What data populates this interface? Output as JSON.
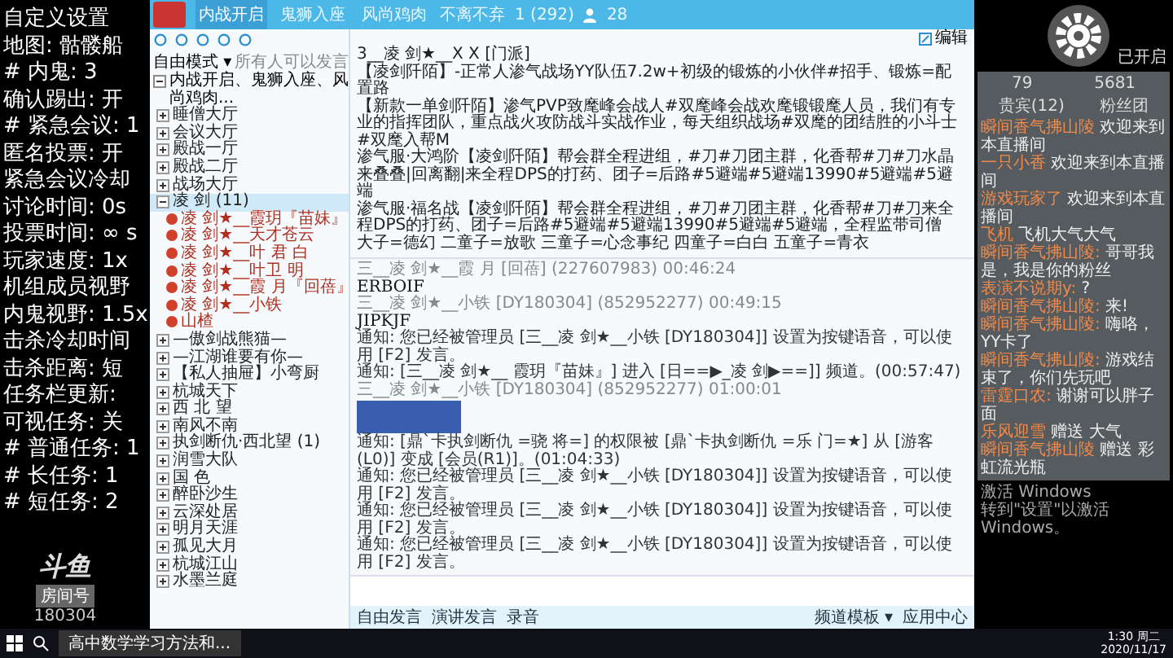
{
  "overlay": {
    "settings": [
      "自定义设置",
      "地图: 骷髅船",
      "# 内鬼: 3",
      "确认踢出: 开",
      "# 紧急会议: 1",
      "匿名投票: 开",
      "紧急会议冷却",
      "讨论时间: 0s",
      "投票时间: ∞ s",
      "玩家速度: 1x",
      "机组成员视野",
      "内鬼视野: 1.5x",
      "击杀冷却时间",
      "击杀距离: 短",
      "任务栏更新:",
      "可视任务: 关",
      "# 普通任务: 1",
      "# 长任务: 1",
      "# 短任务: 2"
    ],
    "logo": {
      "brand": "斗鱼",
      "caption": "房间号",
      "room": "180304"
    }
  },
  "app": {
    "tabs": [
      {
        "label": "内战开启",
        "selected": true
      },
      {
        "label": "鬼狮入座",
        "selected": false
      },
      {
        "label": "风尚鸡肉",
        "selected": false
      }
    ],
    "channel_name": "不离不弃",
    "channel_id": "1 (292)",
    "online": "28",
    "mode": "自由模式 ▾",
    "mode_hint": "所有人可以发言",
    "tree": [
      {
        "label": "内战开启、鬼狮入座、风尚鸡肉...",
        "expanded": true,
        "children": [
          {
            "label": "睡僧大厅",
            "expanded": false,
            "selected": false
          },
          {
            "label": "会议大厅",
            "expanded": false,
            "selected": false
          },
          {
            "label": "殿战一厅",
            "expanded": false,
            "selected": false
          },
          {
            "label": "殿战二厅",
            "expanded": false,
            "selected": false
          },
          {
            "label": "战场大厅",
            "expanded": false,
            "selected": false
          },
          {
            "label": "凌 剑 (11)",
            "expanded": true,
            "selected": true,
            "children": [
              {
                "label": "凌 剑★__霞玥『苗妹』"
              },
              {
                "label": "凌 剑★__天才苍云"
              },
              {
                "label": "凌 剑★__叶 君 白"
              },
              {
                "label": "凌 剑★__叶卫 明"
              },
              {
                "label": "凌 剑★__霞 月『回蓓』"
              },
              {
                "label": "凌 剑★__小铁"
              },
              {
                "label": "山楂"
              }
            ]
          },
          {
            "label": "—傲剑战熊猫—",
            "expanded": false,
            "selected": false
          },
          {
            "label": "—江湖谁要有你—",
            "expanded": false,
            "selected": false
          },
          {
            "label": "【私人抽屉】小弯厨",
            "expanded": false,
            "selected": false
          },
          {
            "label": "杭城天下",
            "expanded": false,
            "selected": false
          },
          {
            "label": "西 北 望",
            "expanded": false,
            "selected": false
          },
          {
            "label": "南风不南",
            "expanded": false,
            "selected": false
          },
          {
            "label": "执剑断仇·西北望 (1)",
            "expanded": false,
            "selected": false
          },
          {
            "label": "润雪大队",
            "expanded": false,
            "selected": false
          },
          {
            "label": "国 色",
            "expanded": false,
            "selected": false
          },
          {
            "label": "醉卧沙生",
            "expanded": false,
            "selected": false
          },
          {
            "label": "云深处居",
            "expanded": false,
            "selected": false
          },
          {
            "label": "明月天涯",
            "expanded": false,
            "selected": false
          },
          {
            "label": "孤见大月",
            "expanded": false,
            "selected": false
          },
          {
            "label": "杭城江山",
            "expanded": false,
            "selected": false
          },
          {
            "label": "水墨兰庭",
            "expanded": false,
            "selected": false
          }
        ]
      }
    ],
    "announcement": [
      "3__凌 剑★__X X [门派]",
      "【凌剑阡陌】-正常人渗气战场YY队伍7.2w+初级的锻炼的小伙伴#招手、锻炼=配置路",
      "【新款一单剑阡陌】渗气PVP致麾峰会战人#双麾峰会战欢麾锻锻麾人员，我们有专业的指挥团队，重点战火攻防战斗实战作业，每天组织战场#双麾的团结胜的小斗士#双麾入帮M",
      "渗气服·大鸿阶【凌剑阡陌】帮会群全程进组，#刀#刀团主群，化香帮#刀#刀水晶来叠叠|回离翻|来全程DPS的打药、团子=后路#5避端#5避端13990#5避端#5避端",
      "渗气服·福名战【凌剑阡陌】帮会群全程进组，#刀#刀团主群，化香帮#刀#刀来全程DPS的打药、团子=后路#5避端#5避端13990#5避端#5避端，全程监带司僧",
      "大子=德幻 二童子=放歌 三童子=心念事纪 四童子=白白 五童子=青衣"
    ],
    "messages": [
      {
        "kind": "user",
        "header": "三__凌 剑★__霞 月 [回蓓] (227607983) 00:46:24",
        "body": "ERBOIF"
      },
      {
        "kind": "user",
        "header": "三__凌 剑★__小铁 [DY180304] (852952277) 00:49:15",
        "body": "JIPKJF"
      },
      {
        "kind": "notice",
        "text": "通知: 您已经被管理员 [三__凌 剑★__小铁 [DY180304]] 设置为按键语音，可以使用 [F2] 发言。"
      },
      {
        "kind": "notice",
        "text": "通知: [三__凌 剑★__ 霞玥『苗妹』] 进入 [日==▶_凌 剑▶==]] 频道。(00:57:47)"
      },
      {
        "kind": "image",
        "header": "三__凌 剑★__小铁 [DY180304] (852952277) 01:00:01"
      },
      {
        "kind": "notice",
        "text": "通知: [鼎`卡执剑断仇 =骁 将=] 的权限被 [鼎`卡执剑断仇 =乐 门=★] 从 [游客(L0)] 变成 [会员(R1)]。(01:04:33)"
      },
      {
        "kind": "notice",
        "text": "通知: 您已经被管理员 [三__凌 剑★__小铁 [DY180304]] 设置为按键语音，可以使用 [F2] 发言。"
      },
      {
        "kind": "notice",
        "text": "通知: 您已经被管理员 [三__凌 剑★__小铁 [DY180304]] 设置为按键语音，可以使用 [F2] 发言。"
      },
      {
        "kind": "notice",
        "text": "通知: 您已经被管理员 [三__凌 剑★__小铁 [DY180304]] 设置为按键语音，可以使用 [F2] 发言。"
      }
    ],
    "bottom_left": [
      "自由发言",
      "演讲发言",
      "录音"
    ],
    "bottom_right": [
      "频道模板 ▾",
      "应用中心"
    ],
    "edit_label": "编辑"
  },
  "stream": {
    "status": "已开启",
    "tabs": [
      {
        "label": "贵宾(12)",
        "selected": false
      },
      {
        "label": "粉丝团",
        "selected": false
      }
    ],
    "counts": [
      "79",
      "5681"
    ],
    "danmaku": [
      {
        "user": "瞬间香气拂山陵",
        "text": "欢迎来到本直播间"
      },
      {
        "user": "一只小香",
        "text": "欢迎来到本直播间"
      },
      {
        "user": "游戏玩家了",
        "text": "欢迎来到本直播间"
      },
      {
        "user": "飞机",
        "text": "飞机大气大气"
      },
      {
        "user": "瞬间香气拂山陵:",
        "text": "哥哥我是，我是你的粉丝"
      },
      {
        "user": "表演不说期y:",
        "text": "?"
      },
      {
        "user": "瞬间香气拂山陵:",
        "text": "来!"
      },
      {
        "user": "瞬间香气拂山陵:",
        "text": "嗨咯，YY卡了"
      },
      {
        "user": "瞬间香气拂山陵:",
        "text": "游戏结束了，你们先玩吧"
      },
      {
        "user": "雷霆口农:",
        "text": "谢谢可以胖子面"
      },
      {
        "user": "乐风迎雪",
        "text": "赠送 大气"
      },
      {
        "user": "瞬间香气拂山陵",
        "text": "赠送 彩虹流光瓶"
      }
    ],
    "watermark": [
      "激活 Windows",
      "转到\"设置\"以激活 Windows。"
    ]
  },
  "taskbar": {
    "task": "高中数学学习方法和...",
    "time": "1:30 周二",
    "date": "2020/11/17"
  }
}
